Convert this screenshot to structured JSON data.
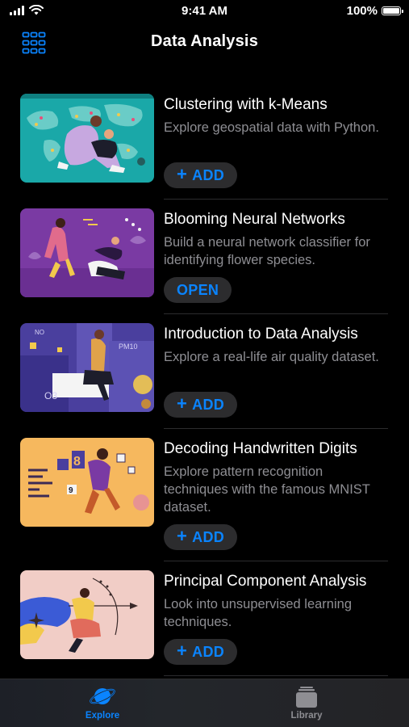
{
  "status_bar": {
    "time": "9:41 AM",
    "battery": "100%"
  },
  "nav": {
    "title": "Data Analysis",
    "menu_icon": "grid-icon"
  },
  "courses": [
    {
      "title": "Clustering with k-Means",
      "description": "Explore geospatial data with Python.",
      "action": "ADD",
      "action_icon": "plus-icon"
    },
    {
      "title": "Blooming Neural Networks",
      "description": "Build a neural network classifier for identifying flower species.",
      "action": "OPEN"
    },
    {
      "title": "Introduction to Data Analysis",
      "description": "Explore a real-life air quality dataset.",
      "action": "ADD",
      "action_icon": "plus-icon",
      "thumb_text": [
        "NO",
        "PM10",
        "O3"
      ]
    },
    {
      "title": "Decoding Handwritten Digits",
      "description": "Explore pattern recognition techniques with the famous MNIST dataset.",
      "action": "ADD",
      "action_icon": "plus-icon",
      "thumb_text": [
        "8",
        "9"
      ]
    },
    {
      "title": "Principal Component Analysis",
      "description": "Look into unsupervised learning techniques.",
      "action": "ADD",
      "action_icon": "plus-icon"
    }
  ],
  "tab_bar": {
    "tabs": [
      {
        "label": "Explore",
        "icon": "planet-icon",
        "selected": true
      },
      {
        "label": "Library",
        "icon": "stack-icon",
        "selected": false
      }
    ]
  },
  "colors": {
    "accent": "#0a84ff",
    "secondary_text": "#8e8e93",
    "button_bg": "#2c2c2e"
  }
}
